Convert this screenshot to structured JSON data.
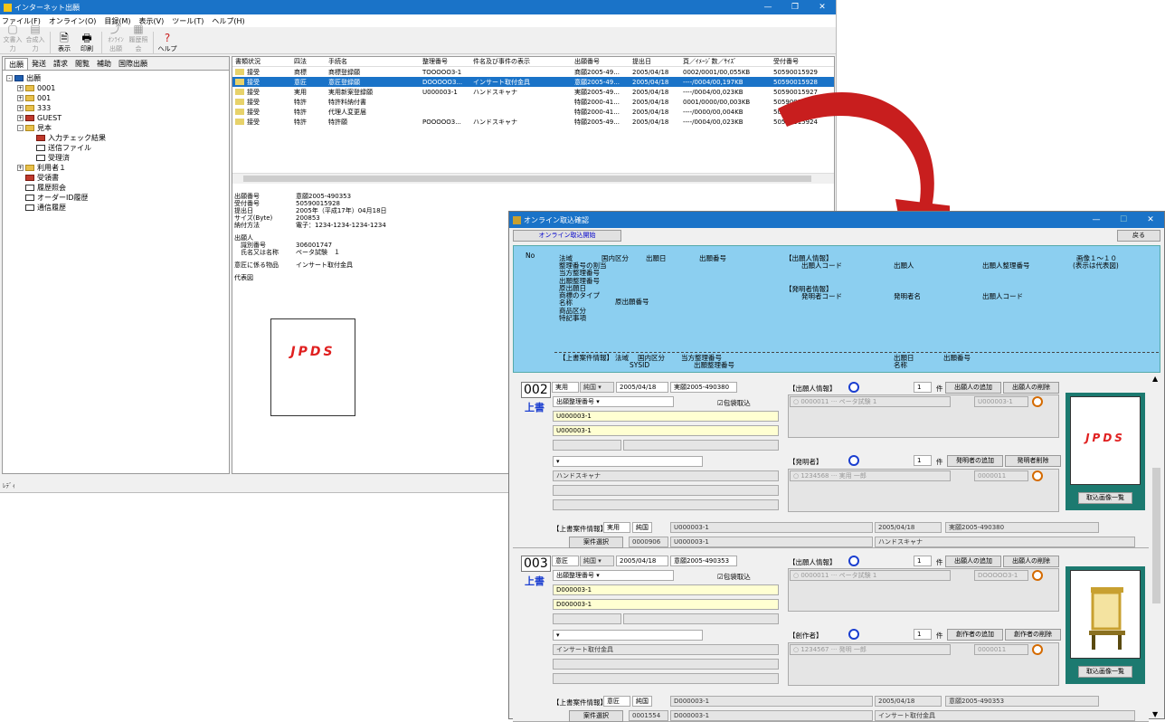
{
  "win1": {
    "title": "インターネット出願",
    "menu": [
      "ファイル(F)",
      "オンライン(O)",
      "目録(M)",
      "表示(V)",
      "ツール(T)",
      "ヘルプ(H)"
    ],
    "toolbar": [
      {
        "label": "文書入力",
        "enabled": false
      },
      {
        "label": "合成入力",
        "enabled": false
      },
      {
        "label": "表示",
        "enabled": true
      },
      {
        "label": "印刷",
        "enabled": true
      },
      {
        "label": "ｵﾝﾗｲﾝ出願",
        "enabled": false
      },
      {
        "label": "履歴照会",
        "enabled": false
      },
      {
        "label": "ヘルプ",
        "enabled": true
      }
    ],
    "tabs": [
      "出願",
      "発送",
      "請求",
      "閲覧",
      "補助",
      "国際出願"
    ],
    "tree": [
      {
        "label": "出願",
        "depth": 0,
        "exp": "-",
        "icon": "blue"
      },
      {
        "label": "0001",
        "depth": 1,
        "exp": "+",
        "icon": "yellow"
      },
      {
        "label": "001",
        "depth": 1,
        "exp": "+",
        "icon": "yellow"
      },
      {
        "label": "333",
        "depth": 1,
        "exp": "+",
        "icon": "yellow"
      },
      {
        "label": "GUEST",
        "depth": 1,
        "exp": "+",
        "icon": "red"
      },
      {
        "label": "見本",
        "depth": 1,
        "exp": "-",
        "icon": "yellow"
      },
      {
        "label": "入力チェック結果",
        "depth": 2,
        "exp": "",
        "icon": "red"
      },
      {
        "label": "送信ファイル",
        "depth": 2,
        "exp": "",
        "icon": "doc"
      },
      {
        "label": "受理済",
        "depth": 2,
        "exp": "",
        "icon": "doc"
      },
      {
        "label": "利用者１",
        "depth": 1,
        "exp": "+",
        "icon": "yellow"
      },
      {
        "label": "受領書",
        "depth": 1,
        "exp": "",
        "icon": "red"
      },
      {
        "label": "履歴照会",
        "depth": 1,
        "exp": "",
        "icon": "doc"
      },
      {
        "label": "オーダーID履歴",
        "depth": 1,
        "exp": "",
        "icon": "doc"
      },
      {
        "label": "通信履歴",
        "depth": 1,
        "exp": "",
        "icon": "doc"
      }
    ],
    "columns": [
      "書類状況",
      "四法",
      "手続名",
      "整理番号",
      "件名及び事件の表示",
      "出願番号",
      "提出日",
      "頁／ｲﾒｰｼﾞ数／ｻｲｽﾞ",
      "受付番号"
    ],
    "rows": [
      {
        "cells": [
          "接受",
          "商標",
          "商標登録願",
          "TOOOOO3-1",
          "",
          "商願2005-49...",
          "2005/04/18",
          "0002/0001/00,055KB",
          "50590015929"
        ],
        "selected": false
      },
      {
        "cells": [
          "接受",
          "意匠",
          "意匠登録願",
          "DOOOOO3...",
          "インサート取付金具",
          "意願2005-49...",
          "2005/04/18",
          "----/0004/00,197KB",
          "50590015928"
        ],
        "selected": true
      },
      {
        "cells": [
          "接受",
          "実用",
          "実用新案登録願",
          "U000003-1",
          "ハンドスキャナ",
          "実願2005-49...",
          "2005/04/18",
          "----/0004/00,023KB",
          "50590015927"
        ],
        "selected": false
      },
      {
        "cells": [
          "接受",
          "特許",
          "特許料納付書",
          "",
          "",
          "特願2000-41...",
          "2005/04/18",
          "0001/0000/00,003KB",
          "50590015926"
        ],
        "selected": false
      },
      {
        "cells": [
          "接受",
          "特許",
          "代理人変更届",
          "",
          "",
          "特願2000-41...",
          "2005/04/18",
          "----/0000/00,004KB",
          "50590015925"
        ],
        "selected": false
      },
      {
        "cells": [
          "接受",
          "特許",
          "特許願",
          "POOOOO3...",
          "ハンドスキャナ",
          "特願2005-49...",
          "2005/04/18",
          "----/0004/00,023KB",
          "50590015924"
        ],
        "selected": false
      }
    ],
    "detail": [
      {
        "k": "出願番号",
        "v": "意願2005-490353"
      },
      {
        "k": "受付番号",
        "v": "50590015928"
      },
      {
        "k": "提出日",
        "v": "2005年（平成17年）04月18日"
      },
      {
        "k": "サイズ(Byte)",
        "v": "200853"
      },
      {
        "k": "納付方法",
        "v": "電子：1234-1234-1234-1234"
      },
      {
        "k": "",
        "v": ""
      },
      {
        "k": "出願人",
        "v": ""
      },
      {
        "k": "　識別番号",
        "v": "306001747"
      },
      {
        "k": "　氏名又は名称",
        "v": "ペータ試験　１"
      },
      {
        "k": "",
        "v": ""
      },
      {
        "k": "意匠に係る物品",
        "v": "インサート取付金具"
      },
      {
        "k": "",
        "v": ""
      },
      {
        "k": "代表図",
        "v": ""
      }
    ],
    "logo_text": "JPDS",
    "status": "ﾚﾃﾞｨ"
  },
  "win2": {
    "title": "オンライン取込確認",
    "start_btn": "オンライン取込開始",
    "back_btn": "戻る",
    "info": {
      "no": "No",
      "hohiki": "法域",
      "kokunai": "国内区分",
      "shutsuganbi": "出願日",
      "shutsugan_no": "出願番号",
      "left_col": "整理番号の割当\n当方整理番号\n出願整理番号\n原出願日\n商標のタイプ\n名称\n商品区分\n特記事項",
      "gen_no": "原出願番号",
      "app_info": "【出願人情報】",
      "app_code": "出願人コード",
      "app_name": "出願人",
      "app_ref": "出願人整理番号",
      "image": "画像１～１０",
      "image_note": "(表示は代表図)",
      "inv_info": "【発明者情報】",
      "inv_code": "発明者コード",
      "inv_name": "発明者名",
      "inv_app_code": "出願人コード",
      "over_info": "【上書案件情報】",
      "over_hohiki": "法域",
      "over_kokunai": "国内区分",
      "over_tohou": "当方整理番号",
      "sysid": "SYSID",
      "over_ref": "出願整理番号",
      "over_date": "出願日",
      "over_no": "出願番号",
      "over_name": "名称"
    },
    "records": [
      {
        "no": "002",
        "uwagaki": "上書",
        "hohiki": "実用",
        "kokunai": "純国",
        "date": "2005/04/18",
        "app_no": "実願2005-490380",
        "ref_select": "出願整理番号",
        "fukuro": "☑包袋取込",
        "ref1": "U000003-1",
        "ref2": "U000003-1",
        "name": "ハンドスキャナ",
        "app_label": "【出願人情報】",
        "app_count": "1",
        "app_unit": "件",
        "add_app": "出願人の追加",
        "del_app": "出願人の削除",
        "app_code": "0000011",
        "app_name": "ペータ試験 1",
        "app_ref": "U000003-1",
        "inv_label": "【発明者】",
        "inv_count": "1",
        "add_inv": "発明者の追加",
        "del_inv": "発明者削除",
        "inv_code": "1234568",
        "inv_name": "実用 一郎",
        "inv_app": "0000011",
        "img_list": "取込画像一覧",
        "image": "logo",
        "over_label": "【上書案件情報】",
        "o_hohiki": "実用",
        "o_kokunai": "純国",
        "o_ref": "U000003-1",
        "o_date": "2005/04/18",
        "o_app": "実願2005-490380",
        "select_btn": "案件選択",
        "o_sysid": "0000906",
        "o_ref2": "U000003-1",
        "o_name": "ハンドスキャナ"
      },
      {
        "no": "003",
        "uwagaki": "上書",
        "hohiki": "意匠",
        "kokunai": "純国",
        "date": "2005/04/18",
        "app_no": "意願2005-490353",
        "ref_select": "出願整理番号",
        "fukuro": "☑包袋取込",
        "ref1": "D000003-1",
        "ref2": "D000003-1",
        "name": "インサート取付金具",
        "app_label": "【出願人情報】",
        "app_count": "1",
        "app_unit": "件",
        "add_app": "出願人の追加",
        "del_app": "出願人の削除",
        "app_code": "0000011",
        "app_name": "ペータ試験 1",
        "app_ref": "DOOOOO3-1",
        "inv_label": "【創作者】",
        "inv_count": "1",
        "add_inv": "創作者の追加",
        "del_inv": "創作者の削除",
        "inv_code": "1234567",
        "inv_name": "発明 一郎",
        "inv_app": "0000011",
        "img_list": "取込画像一覧",
        "image": "easel",
        "over_label": "【上書案件情報】",
        "o_hohiki": "意匠",
        "o_kokunai": "純国",
        "o_ref": "D000003-1",
        "o_date": "2005/04/18",
        "o_app": "意願2005-490353",
        "select_btn": "案件選択",
        "o_sysid": "0001554",
        "o_ref2": "D000003-1",
        "o_name": "インサート取付金具"
      }
    ]
  },
  "colors": {
    "titlebar": "#1a73c8",
    "selection": "#1a73c8",
    "info_panel": "#8ccff0",
    "arrow": "#c81e1e",
    "image_frame": "#1c7a70"
  }
}
